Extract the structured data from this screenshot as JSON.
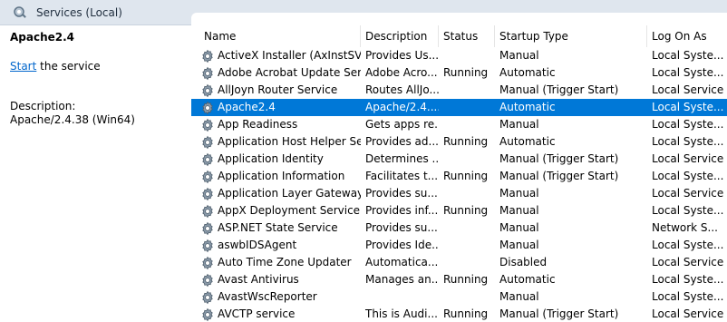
{
  "window": {
    "title": "Services (Local)"
  },
  "left": {
    "service_name": "Apache2.4",
    "start_link": "Start",
    "start_suffix": " the service",
    "description_label": "Description:",
    "description_value": "Apache/2.4.38 (Win64)"
  },
  "columns": {
    "name": "Name",
    "description": "Description",
    "status": "Status",
    "startup": "Startup Type",
    "logon": "Log On As",
    "sort_indicator": "^"
  },
  "colors": {
    "selection": "#0078d7",
    "link": "#0066cc"
  },
  "rows": [
    {
      "name": "ActiveX Installer (AxInstSV)",
      "desc": "Provides Us...",
      "status": "",
      "startup": "Manual",
      "logon": "Local Syste...",
      "selected": false
    },
    {
      "name": "Adobe Acrobat Update Serv...",
      "desc": "Adobe Acro...",
      "status": "Running",
      "startup": "Automatic",
      "logon": "Local Syste...",
      "selected": false
    },
    {
      "name": "AllJoyn Router Service",
      "desc": "Routes AllJo...",
      "status": "",
      "startup": "Manual (Trigger Start)",
      "logon": "Local Service",
      "selected": false
    },
    {
      "name": "Apache2.4",
      "desc": "Apache/2.4....",
      "status": "",
      "startup": "Automatic",
      "logon": "Local Syste...",
      "selected": true
    },
    {
      "name": "App Readiness",
      "desc": "Gets apps re...",
      "status": "",
      "startup": "Manual",
      "logon": "Local Syste...",
      "selected": false
    },
    {
      "name": "Application Host Helper Ser...",
      "desc": "Provides ad...",
      "status": "Running",
      "startup": "Automatic",
      "logon": "Local Syste...",
      "selected": false
    },
    {
      "name": "Application Identity",
      "desc": "Determines ...",
      "status": "",
      "startup": "Manual (Trigger Start)",
      "logon": "Local Service",
      "selected": false
    },
    {
      "name": "Application Information",
      "desc": "Facilitates t...",
      "status": "Running",
      "startup": "Manual (Trigger Start)",
      "logon": "Local Syste...",
      "selected": false
    },
    {
      "name": "Application Layer Gateway ...",
      "desc": "Provides su...",
      "status": "",
      "startup": "Manual",
      "logon": "Local Service",
      "selected": false
    },
    {
      "name": "AppX Deployment Service (...",
      "desc": "Provides inf...",
      "status": "Running",
      "startup": "Manual",
      "logon": "Local Syste...",
      "selected": false
    },
    {
      "name": "ASP.NET State Service",
      "desc": "Provides su...",
      "status": "",
      "startup": "Manual",
      "logon": "Network S...",
      "selected": false
    },
    {
      "name": "aswbIDSAgent",
      "desc": "Provides Ide...",
      "status": "",
      "startup": "Manual",
      "logon": "Local Syste...",
      "selected": false
    },
    {
      "name": "Auto Time Zone Updater",
      "desc": "Automatica...",
      "status": "",
      "startup": "Disabled",
      "logon": "Local Service",
      "selected": false
    },
    {
      "name": "Avast Antivirus",
      "desc": "Manages an...",
      "status": "Running",
      "startup": "Automatic",
      "logon": "Local Syste...",
      "selected": false
    },
    {
      "name": "AvastWscReporter",
      "desc": "",
      "status": "",
      "startup": "Manual",
      "logon": "Local Syste...",
      "selected": false
    },
    {
      "name": "AVCTP service",
      "desc": "This is Audi...",
      "status": "Running",
      "startup": "Manual (Trigger Start)",
      "logon": "Local Service",
      "selected": false
    }
  ]
}
